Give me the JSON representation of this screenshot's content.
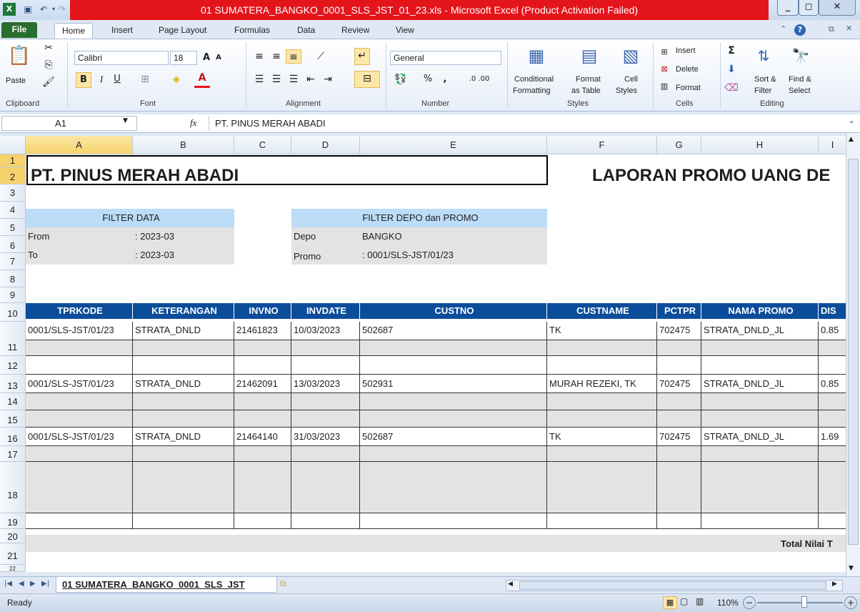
{
  "window": {
    "title": "01 SUMATERA_BANGKO_0001_SLS_JST_01_23.xls  -  Microsoft Excel (Product Activation Failed)",
    "title_bar_color": "#e4141b"
  },
  "ribbon_tabs": [
    "File",
    "Home",
    "Insert",
    "Page Layout",
    "Formulas",
    "Data",
    "Review",
    "View"
  ],
  "ribbon": {
    "clipboard": {
      "paste_label": "Paste",
      "group_label": "Clipboard"
    },
    "font": {
      "font_name": "Calibri",
      "font_size": "18",
      "bold": "B",
      "italic": "I",
      "underline": "U",
      "group_label": "Font"
    },
    "alignment": {
      "group_label": "Alignment"
    },
    "number": {
      "format": "General",
      "percent": "%",
      "comma": ",",
      "inc_decimal": ".0 .00",
      "group_label": "Number"
    },
    "styles": {
      "conditional": "Conditional",
      "conditional2": "Formatting",
      "format_table": "Format",
      "format_table2": "as Table",
      "cell_styles": "Cell",
      "cell_styles2": "Styles",
      "group_label": "Styles"
    },
    "cells": {
      "insert": "Insert",
      "delete": "Delete",
      "format": "Format",
      "group_label": "Cells"
    },
    "editing": {
      "sigma": "Σ",
      "sort": "Sort &",
      "sort2": "Filter",
      "find": "Find &",
      "find2": "Select",
      "group_label": "Editing"
    }
  },
  "formula_bar": {
    "name_box": "A1",
    "fx": "fx",
    "content": "PT. PINUS MERAH ABADI"
  },
  "columns": [
    "A",
    "B",
    "C",
    "D",
    "E",
    "F",
    "G",
    "H",
    "I"
  ],
  "rows": [
    "1",
    "2",
    "3",
    "4",
    "5",
    "6",
    "7",
    "8",
    "9",
    "10",
    "11",
    "12",
    "13",
    "14",
    "15",
    "16",
    "17",
    "18",
    "19",
    "20",
    "21",
    "22"
  ],
  "sheet": {
    "company": "PT. PINUS MERAH ABADI",
    "report_title": "LAPORAN PROMO UANG DE",
    "filter_data": {
      "header": "FILTER DATA",
      "from_label": "From",
      "from_value": ": 2023-03",
      "to_label": "To",
      "to_value": ": 2023-03"
    },
    "filter_depo": {
      "header": "FILTER DEPO dan PROMO",
      "depo_label": "Depo",
      "depo_value": "BANGKO",
      "promo_label": "Promo",
      "promo_value": ": 0001/SLS-JST/01/23"
    },
    "table_headers": [
      "TPRKODE",
      "KETERANGAN",
      "INVNO",
      "INVDATE",
      "CUSTNO",
      "CUSTNAME",
      "PCTPR",
      "NAMA PROMO",
      "DIS"
    ],
    "rows": [
      {
        "tprkode": "0001/SLS-JST/01/23",
        "keterangan": "STRATA_DNLD",
        "invno": "21461823",
        "invdate": "10/03/2023",
        "custno": "502687",
        "custname": "TK",
        "pctpr": "702475",
        "nama_promo": "STRATA_DNLD_JL",
        "dis": "0.85"
      },
      {
        "tprkode": "0001/SLS-JST/01/23",
        "keterangan": "STRATA_DNLD",
        "invno": "21462091",
        "invdate": "13/03/2023",
        "custno": "502931",
        "custname": "MURAH REZEKI, TK",
        "pctpr": "702475",
        "nama_promo": "STRATA_DNLD_JL",
        "dis": "0.85"
      },
      {
        "tprkode": "0001/SLS-JST/01/23",
        "keterangan": "STRATA_DNLD",
        "invno": "21464140",
        "invdate": "31/03/2023",
        "custno": "502687",
        "custname": "TK",
        "pctpr": "702475",
        "nama_promo": "STRATA_DNLD_JL",
        "dis": "1.69"
      }
    ],
    "total_label": "Total Nilai T"
  },
  "sheet_tab": "01 SUMATERA_BANGKO_0001_SLS_JST",
  "status": {
    "ready": "Ready",
    "zoom": "110%"
  }
}
